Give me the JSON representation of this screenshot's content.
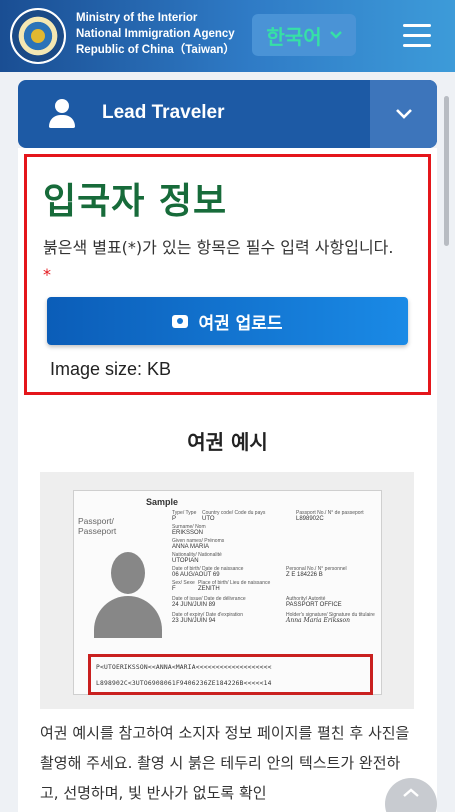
{
  "header": {
    "agency_lines": [
      "Ministry of the Interior",
      "National Immigration Agency",
      "Republic of China（Taiwan）"
    ],
    "language_label": "한국어",
    "menu_icon": "hamburger-icon"
  },
  "lead_traveler": {
    "label": "Lead Traveler",
    "icon": "person-icon",
    "toggle_icon": "chevron-down-icon"
  },
  "entrant_info": {
    "title": "입국자 정보",
    "description": "붉은색 별표(*)가 있는 항목은 필수 입력 사항입니다.",
    "required_marker": "*",
    "upload_button": "여권 업로드",
    "upload_icon": "camera-icon",
    "image_size": "Image size: KB"
  },
  "passport_example": {
    "title": "여권 예시",
    "sample_label": "Sample",
    "passport_label": "Passport/ Passeport",
    "fields": {
      "type_label": "Type/ Type",
      "type": "P",
      "country_label": "Country code/ Code du pays",
      "country": "UTO",
      "passport_no_label": "Passport No./ N° de passeport",
      "passport_no": "L898902C",
      "surname_label": "Surname/ Nom",
      "surname": "ERIKSSON",
      "given_label": "Given names/ Prénoms",
      "given": "ANNA MARIA",
      "nationality_label": "Nationality/ Nationalité",
      "nationality": "UTOPIAN",
      "dob_label": "Date of birth/ Date de naissance",
      "dob": "06 AUG/AOÛT 69",
      "personal_no_label": "Personal No./ N° personnel",
      "personal_no": "Z E 184226 B",
      "sex_label": "Sex/ Sexe",
      "sex": "F",
      "pob_label": "Place of birth/ Lieu de naissance",
      "pob": "ZENITH",
      "issue_label": "Date of issue/ Date de délivrance",
      "issue": "24 JUN/JUIN 89",
      "authority_label": "Authority/ Autorité",
      "authority": "PASSPORT OFFICE",
      "expiry_label": "Date of expiry/ Date d'expiration",
      "expiry": "23 JUN/JUIN 94",
      "signature_label": "Holder's signature/ Signature du titulaire",
      "signature_text": "Anna Maria Eriksson"
    },
    "mrz_line1": "P<UTOERIKSSON<<ANNA<MARIA<<<<<<<<<<<<<<<<<<<",
    "mrz_line2": "L898902C<3UTO6908061F9406236ZE184226B<<<<<14"
  },
  "instructions": "여권 예시를 참고하여 소지자 정보 페이지를 펼친 후 사진을 촬영해 주세요. 촬영 시 붉은 테두리 안의 텍스트가 완전하고, 선명하며, 빛 반사가 없도록 확인",
  "scroll_top_icon": "chevron-up-icon"
}
